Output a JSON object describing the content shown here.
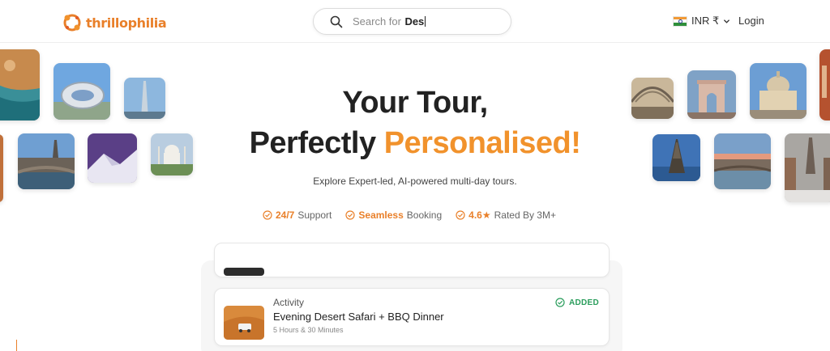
{
  "header": {
    "logo_text_1": "thrill",
    "logo_text_2": "ophilia",
    "search": {
      "prefix": "Search for",
      "typed": "Des"
    },
    "currency": {
      "code": "INR ₹",
      "flag_icon": "india-flag-icon"
    },
    "login_label": "Login"
  },
  "hero": {
    "title_line1": "Your Tour,",
    "title_line2_plain": "Perfectly",
    "title_line2_accent": "Personalised!",
    "subtitle": "Explore Expert-led, AI-powered multi-day tours.",
    "features": [
      {
        "bold": "24/7",
        "text": "Support"
      },
      {
        "bold": "Seamless",
        "text": "Booking"
      },
      {
        "bold": "4.6★",
        "text": "Rated By 3M+"
      }
    ]
  },
  "itinerary": {
    "card": {
      "category": "Activity",
      "title": "Evening Desert Safari + BBQ Dinner",
      "duration": "5 Hours & 30 Minutes",
      "status": "ADDED"
    }
  },
  "colors": {
    "brand_orange": "#f1922c",
    "added_green": "#2a9d5c",
    "text_dark": "#222222"
  },
  "tiles": [
    "beach-aerial-photo",
    "museum-of-future-photo",
    "burj-khalifa-photo",
    "city-river-photo",
    "snowy-mountain-photo",
    "taj-mahal-photo",
    "glass-dome-photo",
    "arc-de-triomphe-photo",
    "pantheon-photo",
    "eiffel-tower-photo",
    "river-sunset-photo",
    "snowy-street-photo"
  ]
}
